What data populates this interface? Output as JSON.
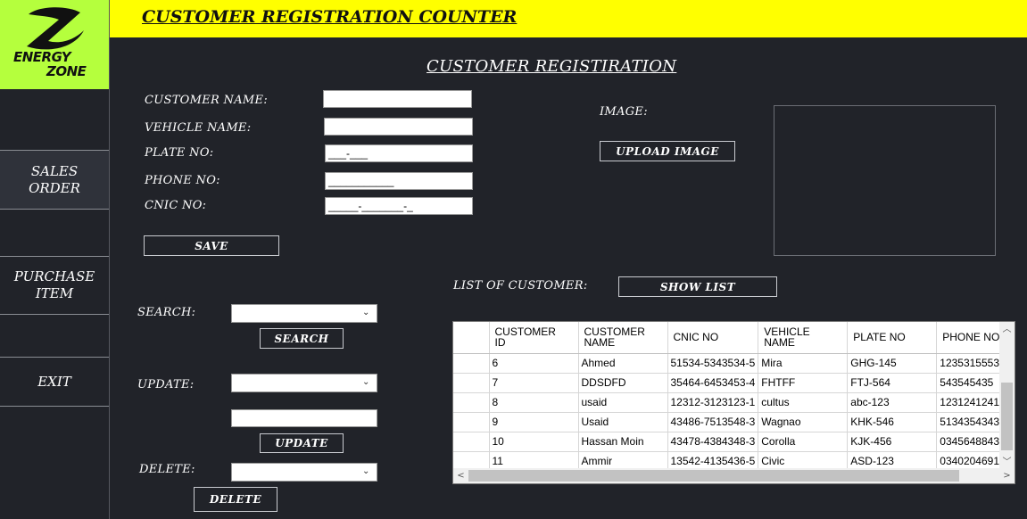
{
  "header": {
    "title": "CUSTOMER REGISTRATION COUNTER"
  },
  "logo": {
    "line1": "ENERGY",
    "line2": "ZONE",
    "icon": "z-swoosh-logo"
  },
  "sidebar": {
    "items": [
      {
        "label_line1": "SALES",
        "label_line2": "ORDER"
      },
      {
        "label_line1": "PURCHASE",
        "label_line2": "ITEM"
      },
      {
        "label_line1": "EXIT",
        "label_line2": ""
      }
    ]
  },
  "form": {
    "title": "CUSTOMER REGISTIRATION",
    "labels": {
      "customer_name": "CUSTOMER NAME:",
      "vehicle_name": "VEHICLE NAME:",
      "plate_no": "PLATE NO:",
      "phone_no": "PHONE NO:",
      "cnic_no": "CNIC NO:",
      "image": "IMAGE:"
    },
    "values": {
      "customer_name": "",
      "vehicle_name": "",
      "plate_no": "___-___",
      "phone_no": "___________",
      "cnic_no": "_____-_______-_"
    },
    "save_label": "SAVE",
    "upload_label": "UPLOAD IMAGE"
  },
  "search": {
    "label": "SEARCH:",
    "value": "",
    "button": "SEARCH"
  },
  "update": {
    "label": "UPDATE:",
    "value": "",
    "text_value": "",
    "button": "UPDATE"
  },
  "delete": {
    "label": "DELETE:",
    "value": "",
    "button": "DELETE"
  },
  "list": {
    "label": "LIST OF CUSTOMER:",
    "button": "SHOW LIST",
    "columns": [
      {
        "line1": "CUSTOMER",
        "line2": "ID"
      },
      {
        "line1": "CUSTOMER",
        "line2": "NAME"
      },
      {
        "line1": "CNIC NO",
        "line2": ""
      },
      {
        "line1": "VEHICLE",
        "line2": "NAME"
      },
      {
        "line1": "PLATE NO",
        "line2": ""
      },
      {
        "line1": "PHONE NO",
        "line2": ""
      }
    ],
    "rows": [
      [
        "6",
        "Ahmed",
        "51534-5343534-5",
        "Mira",
        "GHG-145",
        "1235315553"
      ],
      [
        "7",
        "DDSDFD",
        "35464-6453453-4",
        "FHTFF",
        "FTJ-564",
        "543545435"
      ],
      [
        "8",
        "usaid",
        "12312-3123123-1",
        "cultus",
        "abc-123",
        "1231241241"
      ],
      [
        "9",
        "Usaid",
        "43486-7513548-3",
        "Wagnao",
        "KHK-546",
        "5134354343"
      ],
      [
        "10",
        "Hassan Moin",
        "43478-4384348-3",
        "Corolla",
        "KJK-456",
        "0345648843"
      ],
      [
        "11",
        "Ammir",
        "13542-4135436-5",
        "Civic",
        "ASD-123",
        "0340204691"
      ]
    ]
  },
  "colors": {
    "header_bg": "#ffff00",
    "logo_bg": "#b5ff3d",
    "panel_bg": "#212329"
  }
}
